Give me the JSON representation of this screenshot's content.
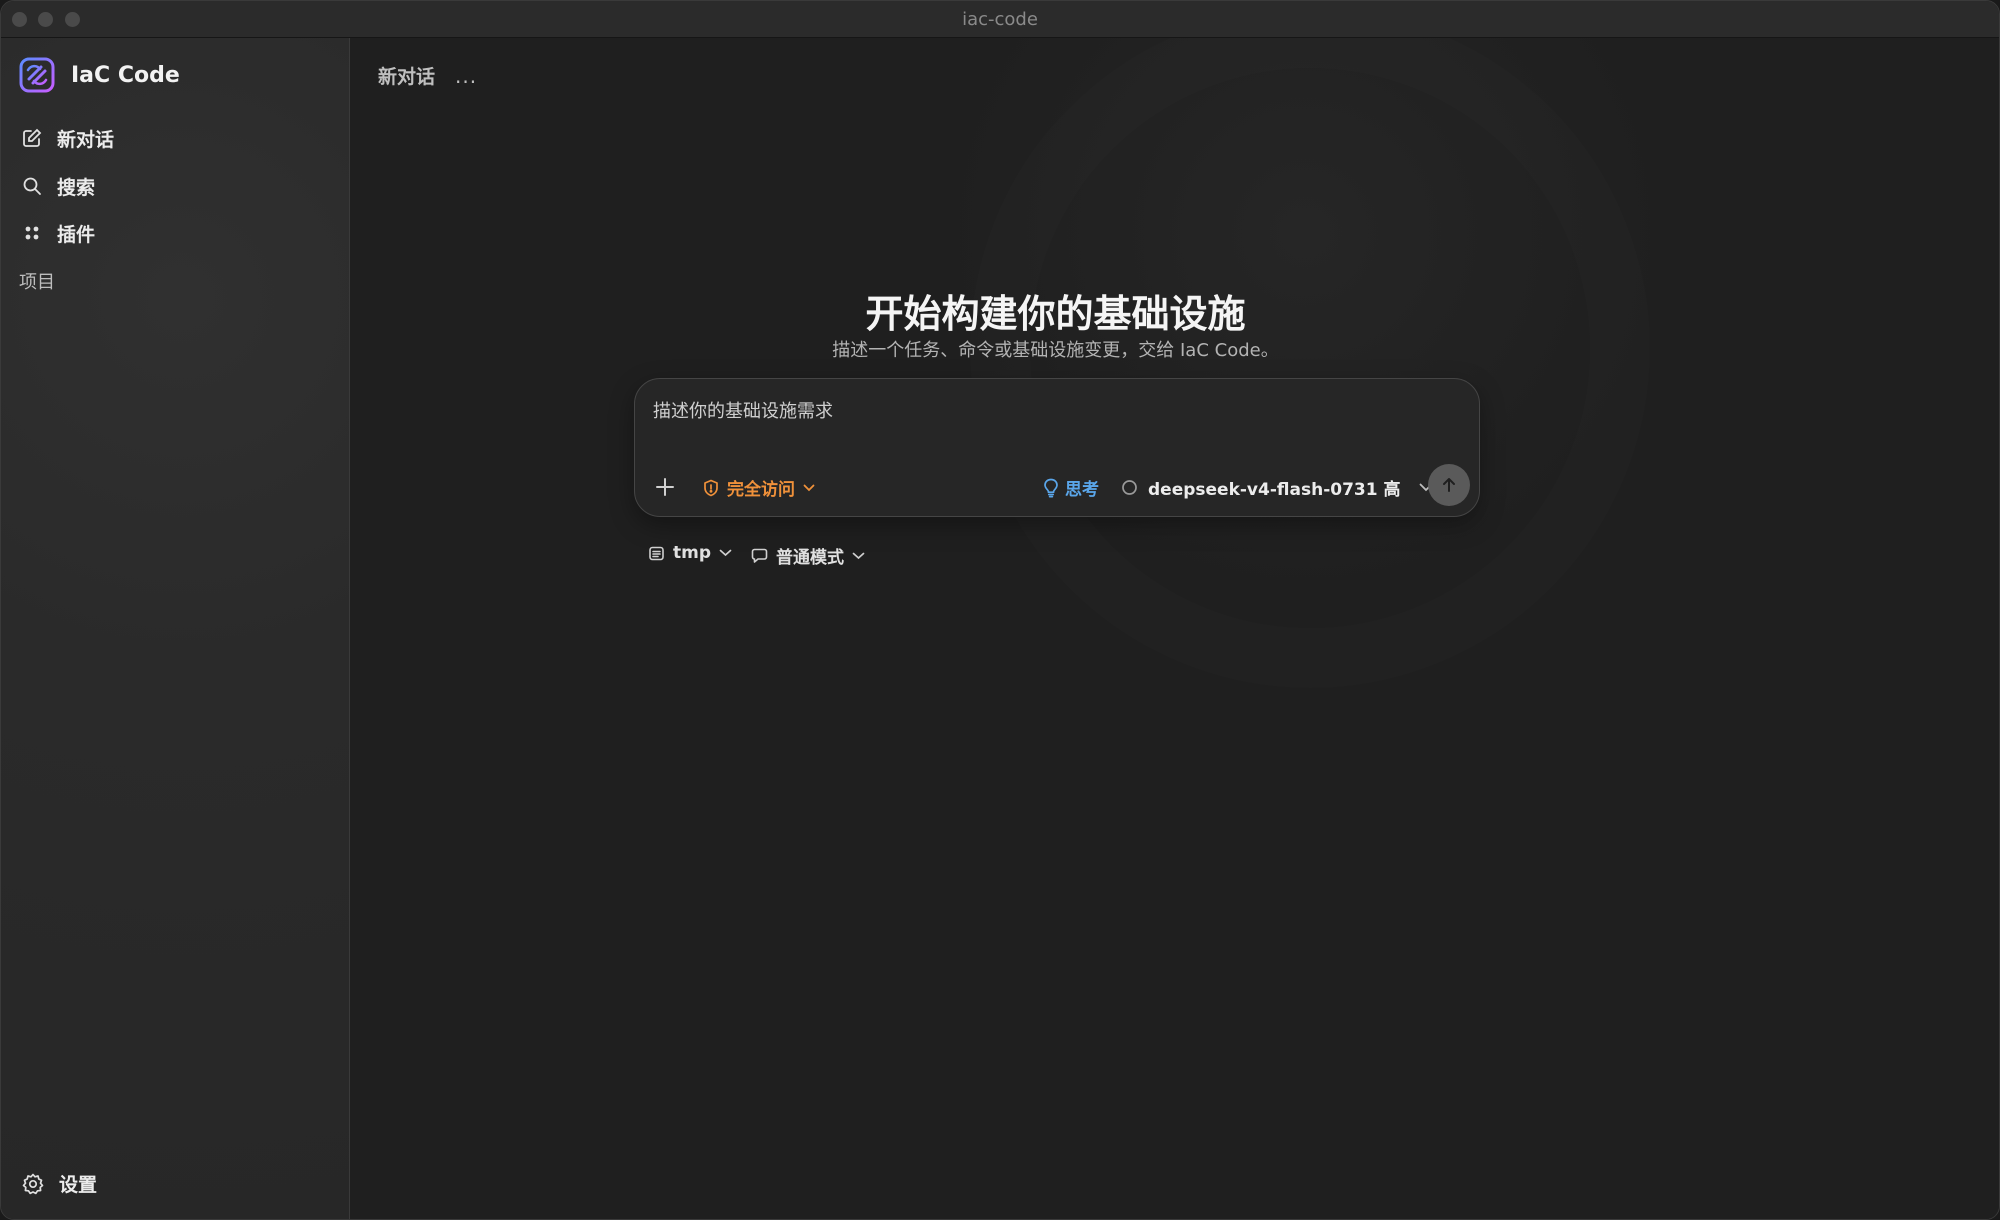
{
  "window": {
    "title": "iac-code"
  },
  "sidebar": {
    "brand": "IaC Code",
    "items": [
      {
        "label": "新对话",
        "icon": "new-chat-icon"
      },
      {
        "label": "搜索",
        "icon": "search-icon"
      },
      {
        "label": "插件",
        "icon": "plugins-icon"
      }
    ],
    "section_label": "项目",
    "settings_label": "设置"
  },
  "main": {
    "breadcrumb_title": "新对话",
    "more_label": "...",
    "hero_title": "开始构建你的基础设施",
    "hero_subtitle": "描述一个任务、命令或基础设施变更，交给 IaC Code。"
  },
  "composer": {
    "placeholder": "描述你的基础设施需求",
    "value": "",
    "access_label": "完全访问",
    "think_label": "思考",
    "model_label": "deepseek-v4-flash-0731 高"
  },
  "below_composer": {
    "folder_label": "tmp",
    "mode_label": "普通模式"
  },
  "colors": {
    "access": "#f0913a",
    "think": "#5aa6ea",
    "brand_gradient": [
      "#5b8cff",
      "#c85cff"
    ]
  }
}
